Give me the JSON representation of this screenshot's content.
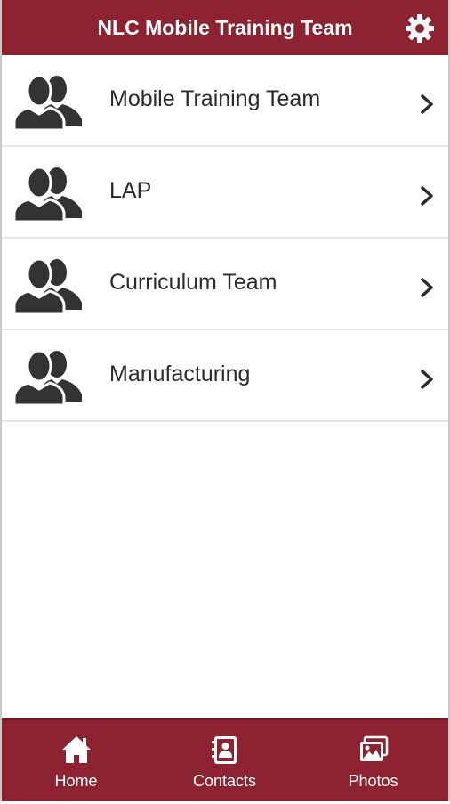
{
  "header": {
    "title": "NLC Mobile Training Team",
    "settings_icon": "gear-icon"
  },
  "list": {
    "items": [
      {
        "label": "Mobile Training Team",
        "icon": "users-icon"
      },
      {
        "label": "LAP",
        "icon": "users-icon"
      },
      {
        "label": "Curriculum Team",
        "icon": "users-icon"
      },
      {
        "label": "Manufacturing",
        "icon": "users-icon"
      }
    ]
  },
  "tabbar": {
    "tabs": [
      {
        "label": "Home",
        "icon": "home-icon"
      },
      {
        "label": "Contacts",
        "icon": "contacts-book-icon"
      },
      {
        "label": "Photos",
        "icon": "photos-icon"
      }
    ]
  },
  "colors": {
    "brand": "#8d2331",
    "text": "#2b2b2b",
    "icon": "#333333"
  }
}
